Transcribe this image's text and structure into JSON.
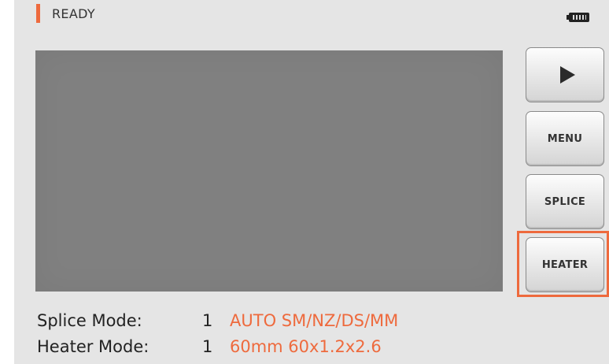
{
  "status": {
    "text": "READY",
    "battery_icon": "battery-full-icon"
  },
  "accent_color": "#ee6a3d",
  "side_buttons": {
    "play_icon": "play-icon",
    "menu_label": "MENU",
    "splice_label": "SPLICE",
    "heater_label": "HEATER",
    "highlighted": "HEATER"
  },
  "info": {
    "splice_mode": {
      "label": "Splice Mode:",
      "number": "1",
      "value": "AUTO SM/NZ/DS/MM"
    },
    "heater_mode": {
      "label": "Heater Mode:",
      "number": "1",
      "value": "60mm 60x1.2x2.6"
    }
  }
}
